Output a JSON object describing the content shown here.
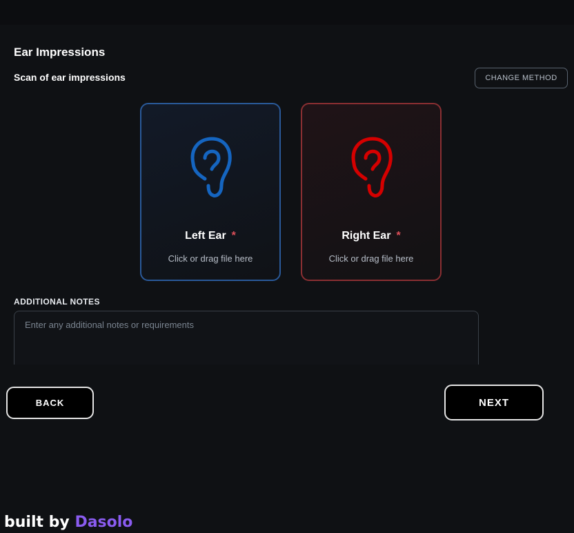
{
  "section": {
    "title": "Ear Impressions",
    "subtitle": "Scan of ear impressions",
    "change_method_label": "CHANGE METHOD"
  },
  "upload_cards": {
    "left": {
      "label": "Left Ear",
      "required_marker": "*",
      "hint": "Click or drag file here",
      "icon": "ear-icon",
      "accent_color": "#1565c0"
    },
    "right": {
      "label": "Right Ear",
      "required_marker": "*",
      "hint": "Click or drag file here",
      "icon": "ear-icon",
      "accent_color": "#d50000"
    }
  },
  "notes": {
    "label": "ADDITIONAL NOTES",
    "placeholder": "Enter any additional notes or requirements",
    "value": ""
  },
  "navigation": {
    "back_label": "BACK",
    "next_label": "NEXT"
  },
  "footer": {
    "prefix": "built by",
    "brand": "Dasolo",
    "brand_color": "#8a5cf0"
  }
}
